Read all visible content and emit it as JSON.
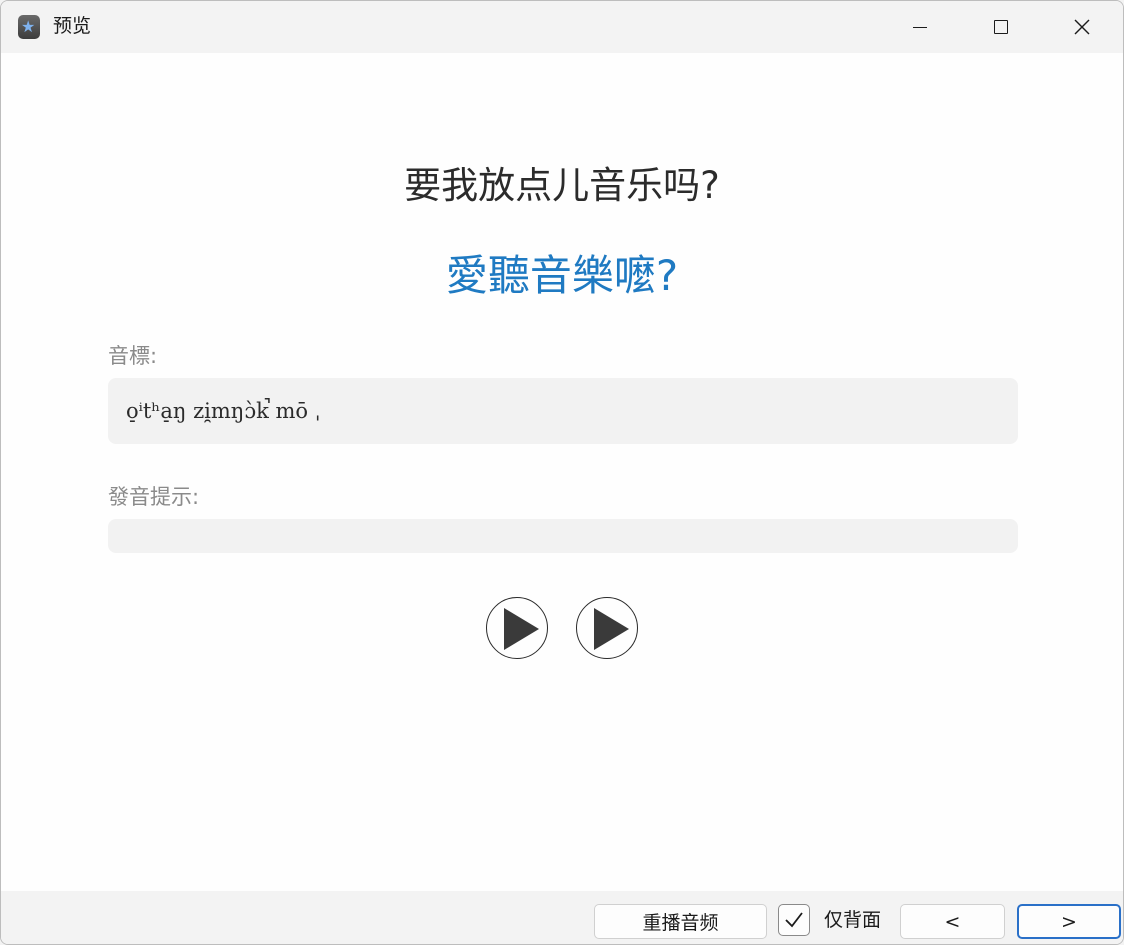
{
  "window": {
    "title": "预览",
    "icons": {
      "app": "app-star-icon",
      "minimize": "minimize-icon",
      "maximize": "maximize-icon",
      "close": "close-icon"
    }
  },
  "card": {
    "question": "要我放点儿音乐吗?",
    "answer": "愛聽音樂嚒?",
    "ipa_label": "音標:",
    "ipa_value": "o̠ⁱtʰa̠ŋ zi̯mŋɔ̀k̚ mō ˌ",
    "hint_label": "發音提示:",
    "hint_value": ""
  },
  "audio": {
    "icon": "play-icon"
  },
  "footer": {
    "replay_label": "重播音频",
    "back_only_label": "仅背面",
    "back_only_checked": true,
    "prev_label": "<",
    "next_label": ">"
  },
  "colors": {
    "accent": "#1f7ac2",
    "focus_border": "#2a70c8"
  }
}
